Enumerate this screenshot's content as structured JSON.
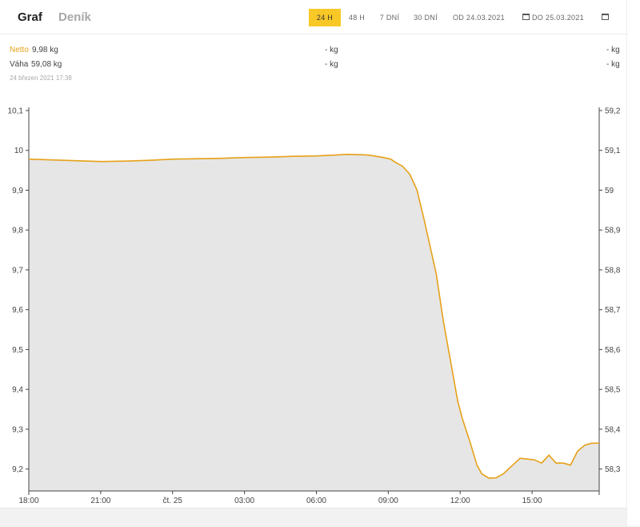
{
  "tabs": [
    {
      "label": "Graf",
      "active": true
    },
    {
      "label": "Deník",
      "active": false
    }
  ],
  "ranges": [
    {
      "label": "24 H",
      "active": true
    },
    {
      "label": "48 H",
      "active": false
    },
    {
      "label": "7 DNÍ",
      "active": false
    },
    {
      "label": "30 DNÍ",
      "active": false
    }
  ],
  "date_from": "OD 24.03.2021",
  "date_to": "DO 25.03.2021",
  "legend": {
    "netto_label": "Netto",
    "netto_value": "9,98 kg",
    "vaha_label": "Váha",
    "vaha_value": "59,08 kg",
    "mid_netto": "- kg",
    "mid_vaha": "- kg",
    "right_netto": "- kg",
    "right_vaha": "- kg",
    "timestamp": "24 březen 2021 17:38"
  },
  "colors": {
    "accent": "#f8c827",
    "line": "#e6a118",
    "area": "#e6e6e6"
  },
  "chart_data": {
    "type": "area",
    "x_tick_labels": [
      "18:00",
      "21:00",
      "čt. 25",
      "03:00",
      "06:00",
      "09:00",
      "12:00",
      "15:00"
    ],
    "x_tick_hours": [
      0,
      3,
      6,
      9,
      12,
      15,
      18,
      21
    ],
    "x_range_hours": [
      0,
      23.8
    ],
    "y_left": {
      "ticks": [
        "10,1",
        "10",
        "9,9",
        "9,8",
        "9,7",
        "9,6",
        "9,5",
        "9,4",
        "9,3",
        "9,2"
      ],
      "tick_values": [
        10.1,
        10.0,
        9.9,
        9.8,
        9.7,
        9.6,
        9.5,
        9.4,
        9.3,
        9.2
      ],
      "range": [
        9.145,
        10.1
      ]
    },
    "y_right": {
      "ticks": [
        "59,2",
        "59,1",
        "59",
        "58,9",
        "58,8",
        "58,7",
        "58,6",
        "58,5",
        "58,4",
        "58,3"
      ],
      "tick_values": [
        59.2,
        59.1,
        59.0,
        58.9,
        58.8,
        58.7,
        58.6,
        58.5,
        58.4,
        58.3
      ],
      "range": [
        58.245,
        59.2
      ]
    },
    "series": [
      {
        "hours": [
          0,
          1,
          2,
          3,
          4,
          5,
          6,
          7,
          8,
          9,
          10,
          11,
          12,
          12.7,
          13.3,
          13.9,
          14.2,
          14.5,
          14.8,
          15.1,
          15.3,
          15.6,
          15.9,
          16.2,
          16.5,
          17.0,
          17.3,
          17.6,
          17.9,
          18.1,
          18.4,
          18.7,
          18.9,
          19.2,
          19.5,
          19.8,
          20.1,
          20.5,
          20.8,
          21.1,
          21.4,
          21.7,
          22.0,
          22.3,
          22.6,
          22.9,
          23.2,
          23.5,
          23.8
        ],
        "values": [
          9.978,
          9.976,
          9.974,
          9.972,
          9.973,
          9.975,
          9.978,
          9.979,
          9.98,
          9.982,
          9.983,
          9.985,
          9.986,
          9.988,
          9.99,
          9.989,
          9.988,
          9.985,
          9.982,
          9.978,
          9.97,
          9.96,
          9.94,
          9.9,
          9.825,
          9.69,
          9.57,
          9.47,
          9.37,
          9.325,
          9.27,
          9.21,
          9.188,
          9.177,
          9.178,
          9.188,
          9.205,
          9.227,
          9.225,
          9.223,
          9.215,
          9.235,
          9.215,
          9.215,
          9.21,
          9.245,
          9.26,
          9.265,
          9.265
        ]
      }
    ]
  }
}
